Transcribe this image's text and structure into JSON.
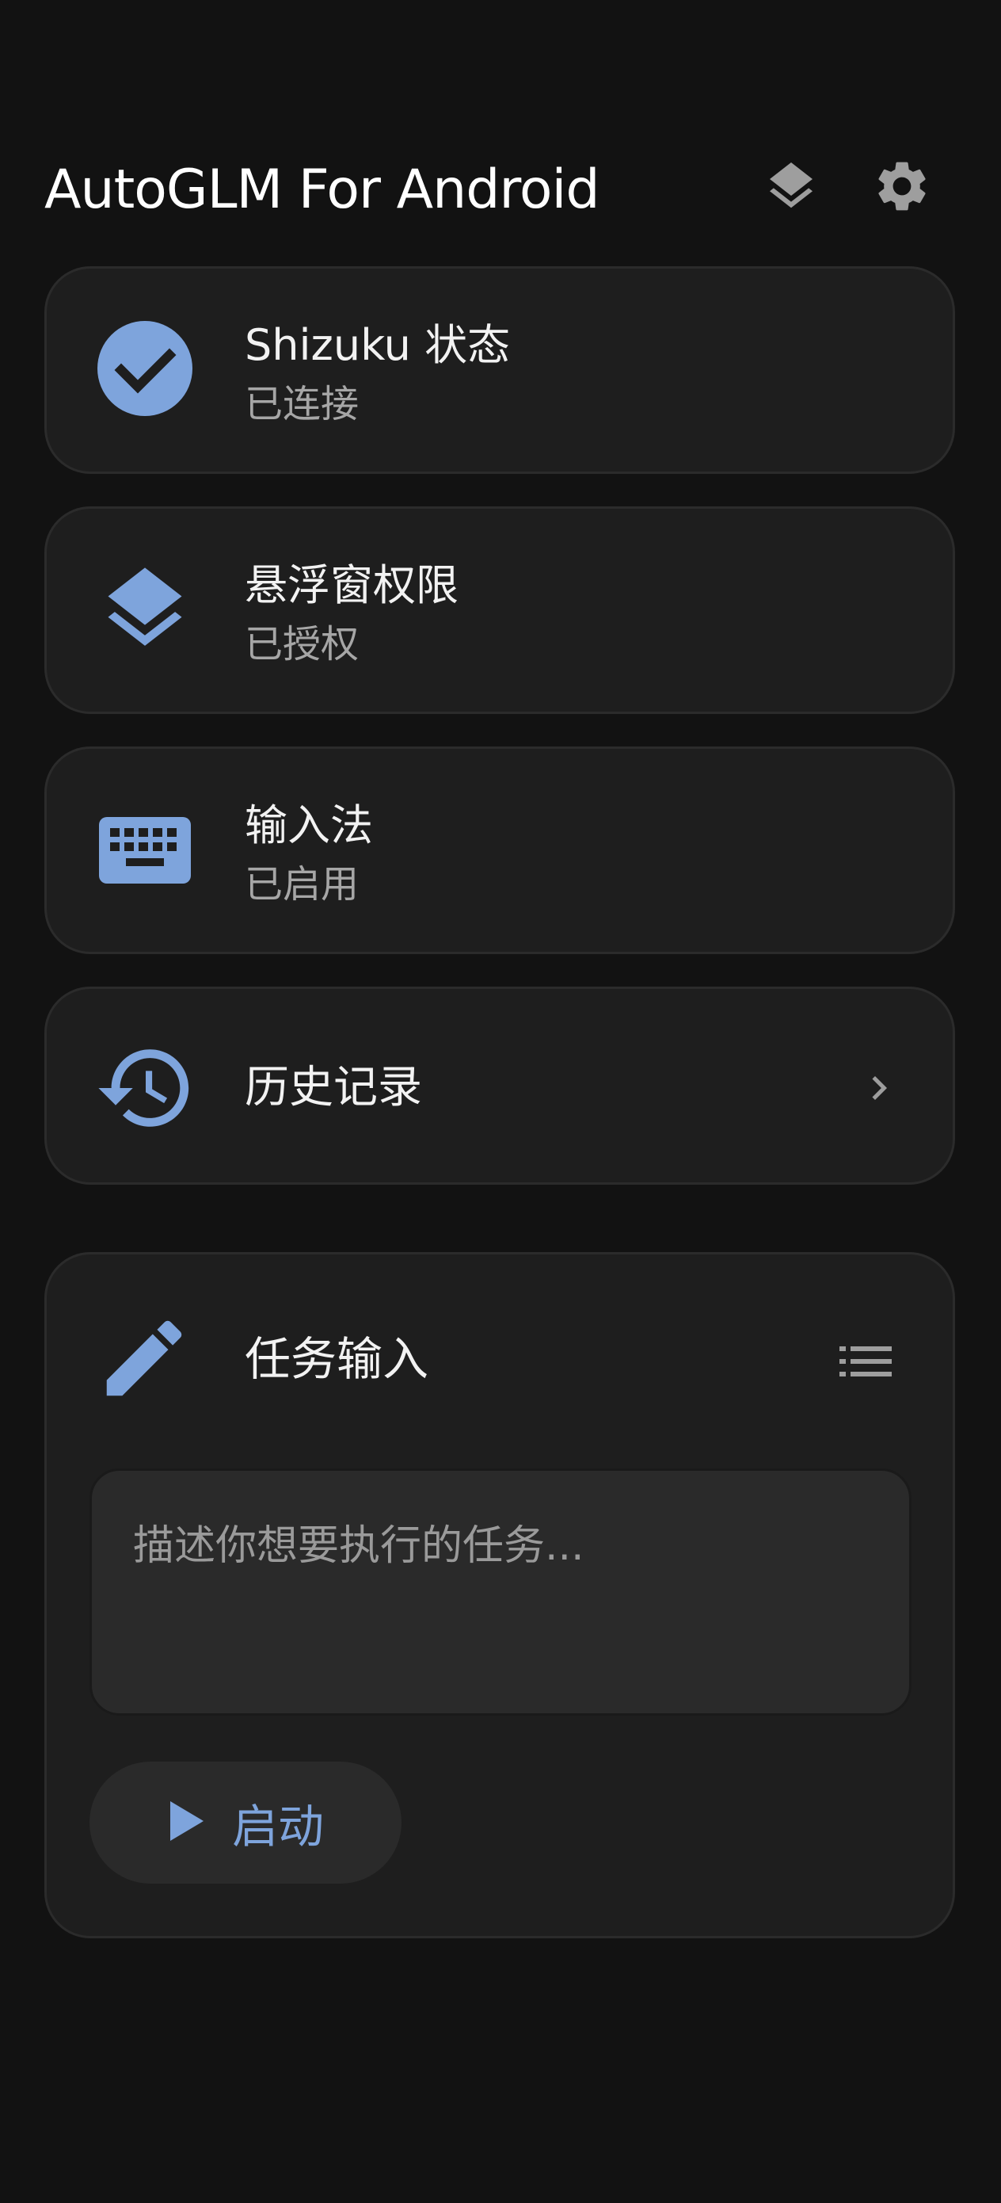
{
  "app": {
    "title": "AutoGLM For Android"
  },
  "colors": {
    "accent": "#7EA4DC",
    "background": "#121212",
    "card": "#1E1E1E",
    "icon_gray": "#9E9E9E"
  },
  "header": {
    "icons": [
      "layers-icon",
      "gear-icon"
    ]
  },
  "status_cards": [
    {
      "icon": "check-circle-icon",
      "title": "Shizuku 状态",
      "status": "已连接"
    },
    {
      "icon": "layers-icon",
      "title": "悬浮窗权限",
      "status": "已授权"
    },
    {
      "icon": "keyboard-icon",
      "title": "输入法",
      "status": "已启用"
    }
  ],
  "history": {
    "icon": "history-icon",
    "title": "历史记录",
    "trailing_icon": "chevron-right-icon"
  },
  "task": {
    "icon": "pencil-icon",
    "title": "任务输入",
    "list_icon": "list-icon",
    "input_placeholder": "描述你想要执行的任务...",
    "input_value": "",
    "start_label": "启动",
    "start_icon": "play-icon"
  }
}
